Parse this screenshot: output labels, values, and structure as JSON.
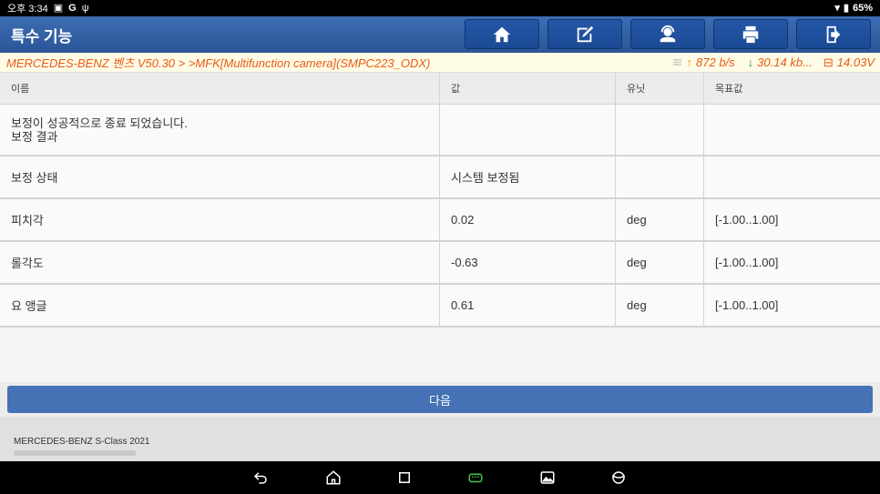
{
  "status_bar": {
    "time": "오후 3:34",
    "g_label": "G",
    "battery": "65%"
  },
  "header": {
    "title": "특수 기능",
    "toolbar": [
      "home-icon",
      "edit-icon",
      "support-icon",
      "print-icon",
      "exit-icon"
    ]
  },
  "breadcrumb": {
    "path": "MERCEDES-BENZ 벤츠 V50.30 >  >MFK[Multifunction camera](SMPC223_ODX)",
    "upload": "872 b/s",
    "download": "30.14 kb...",
    "voltage": "14.03V"
  },
  "table": {
    "columns": [
      "이름",
      "값",
      "유닛",
      "목표값"
    ],
    "message_line1": "보정이 성공적으로 종료 되었습니다.",
    "message_line2": "보정 결과",
    "rows": [
      {
        "name": "보정 상태",
        "value": "시스템 보정됨",
        "unit": "",
        "target": ""
      },
      {
        "name": "피치각",
        "value": "0.02",
        "unit": "deg",
        "target": "[-1.00..1.00]"
      },
      {
        "name": "롤각도",
        "value": "-0.63",
        "unit": "deg",
        "target": "[-1.00..1.00]"
      },
      {
        "name": "요 앵글",
        "value": "0.61",
        "unit": "deg",
        "target": "[-1.00..1.00]"
      }
    ]
  },
  "next_button": "다음",
  "footer": {
    "vehicle": "MERCEDES-BENZ S-Class  2021"
  },
  "colors": {
    "header_blue": "#2f5ea5",
    "breadcrumb_orange": "#e85b14",
    "next_button": "#4472b4"
  }
}
